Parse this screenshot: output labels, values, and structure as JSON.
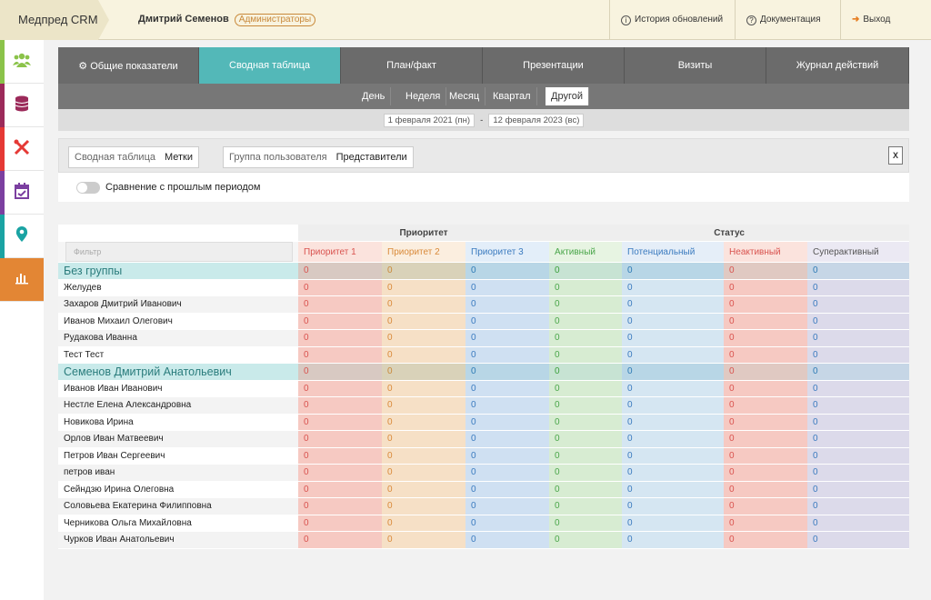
{
  "app": {
    "brand": "Медпред CRM",
    "user": "Дмитрий Семенов",
    "role": "Администраторы"
  },
  "topnav": {
    "history": "История обновлений",
    "docs": "Документация",
    "logout": "Выход"
  },
  "tabs": [
    "Общие показатели",
    "Сводная таблица",
    "План/факт",
    "Презентации",
    "Визиты",
    "Журнал действий"
  ],
  "periods": [
    "День",
    "Неделя",
    "Месяц",
    "Квартал",
    "Другой"
  ],
  "date_from": "1 февраля 2021 (пн)",
  "date_sep": "-",
  "date_to": "12 февраля 2023 (вс)",
  "filters": {
    "table_label": "Сводная таблица",
    "table_value": "Метки",
    "group_label": "Группа пользователя",
    "group_value": "Представители"
  },
  "compare_label": "Сравнение с прошлым периодом",
  "table": {
    "group_headers": {
      "priority": "Приоритет",
      "status": "Статус"
    },
    "filter_placeholder": "Фильтр",
    "columns": [
      "Приоритет 1",
      "Приоритет 2",
      "Приоритет 3",
      "Активный",
      "Потенциальный",
      "Неактивный",
      "Суперактивный"
    ],
    "groups": [
      {
        "name": "Без группы",
        "values": [
          "0",
          "0",
          "0",
          "0",
          "0",
          "0",
          "0"
        ],
        "rows": [
          {
            "name": "Желудев",
            "values": [
              "0",
              "0",
              "0",
              "0",
              "0",
              "0",
              "0"
            ]
          },
          {
            "name": "Захаров Дмитрий Иванович",
            "values": [
              "0",
              "0",
              "0",
              "0",
              "0",
              "0",
              "0"
            ]
          },
          {
            "name": "Иванов Михаил Олегович",
            "values": [
              "0",
              "0",
              "0",
              "0",
              "0",
              "0",
              "0"
            ]
          },
          {
            "name": "Рудакова Иванна",
            "values": [
              "0",
              "0",
              "0",
              "0",
              "0",
              "0",
              "0"
            ]
          },
          {
            "name": "Тест Тест",
            "values": [
              "0",
              "0",
              "0",
              "0",
              "0",
              "0",
              "0"
            ]
          }
        ]
      },
      {
        "name": "Семенов Дмитрий Анатольевич",
        "values": [
          "0",
          "0",
          "0",
          "0",
          "0",
          "0",
          "0"
        ],
        "rows": [
          {
            "name": "Иванов Иван Иванович",
            "values": [
              "0",
              "0",
              "0",
              "0",
              "0",
              "0",
              "0"
            ]
          },
          {
            "name": "Нестле Елена Александровна",
            "values": [
              "0",
              "0",
              "0",
              "0",
              "0",
              "0",
              "0"
            ]
          },
          {
            "name": "Новикова Ирина",
            "values": [
              "0",
              "0",
              "0",
              "0",
              "0",
              "0",
              "0"
            ]
          },
          {
            "name": "Орлов Иван Матвеевич",
            "values": [
              "0",
              "0",
              "0",
              "0",
              "0",
              "0",
              "0"
            ]
          },
          {
            "name": "Петров Иван Сергеевич",
            "values": [
              "0",
              "0",
              "0",
              "0",
              "0",
              "0",
              "0"
            ]
          },
          {
            "name": "петров иван",
            "values": [
              "0",
              "0",
              "0",
              "0",
              "0",
              "0",
              "0"
            ]
          },
          {
            "name": "Сейндзю Ирина Олеговна",
            "values": [
              "0",
              "0",
              "0",
              "0",
              "0",
              "0",
              "0"
            ]
          },
          {
            "name": "Соловьева Екатерина Филипповна",
            "values": [
              "0",
              "0",
              "0",
              "0",
              "0",
              "0",
              "0"
            ]
          },
          {
            "name": "Черникова Ольга Михайловна",
            "values": [
              "0",
              "0",
              "0",
              "0",
              "0",
              "0",
              "0"
            ]
          },
          {
            "name": "Чурков Иван Анатольевич",
            "values": [
              "0",
              "0",
              "0",
              "0",
              "0",
              "0",
              "0"
            ]
          }
        ]
      }
    ]
  },
  "sidebar": [
    {
      "icon": "users-icon",
      "color": "#8bc34a"
    },
    {
      "icon": "database-icon",
      "color": "#9c2a5a"
    },
    {
      "icon": "tools-icon",
      "color": "#e53935"
    },
    {
      "icon": "calendar-icon",
      "color": "#7b3fa0"
    },
    {
      "icon": "map-pin-icon",
      "color": "#1aa3a3"
    },
    {
      "icon": "chart-icon",
      "color": "#e38634"
    }
  ]
}
